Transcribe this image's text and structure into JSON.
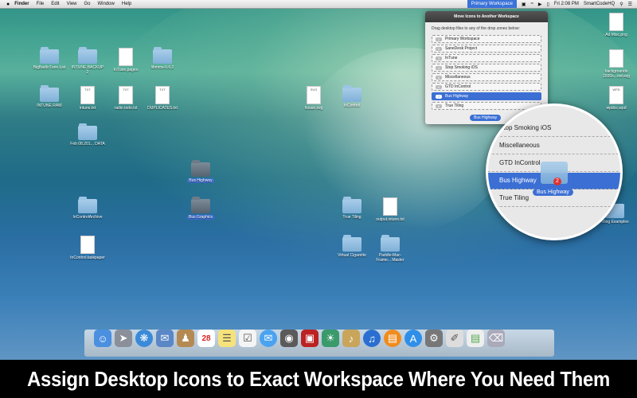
{
  "menubar": {
    "apple": "",
    "items": [
      "Finder",
      "File",
      "Edit",
      "View",
      "Go",
      "Window",
      "Help"
    ],
    "workspace": "Primary Workspace",
    "clock": "Fri 2:08 PM",
    "user": "SmartCodeHQ"
  },
  "panel": {
    "title": "Move Icons to Another Workspace",
    "instructions": "Drag desktop files to any of the drop zones below:",
    "zones": [
      {
        "n": "1",
        "label": "Primary Workspace"
      },
      {
        "n": "2",
        "label": "SaneDesk Project"
      },
      {
        "n": "3",
        "label": "InTune"
      },
      {
        "n": "4",
        "label": "Stop Smoking iOS"
      },
      {
        "n": "5",
        "label": "Miscellaneous"
      },
      {
        "n": "6",
        "label": "GTD InControl"
      },
      {
        "n": "7",
        "label": "Bus Highway"
      },
      {
        "n": "8",
        "label": "True Tiling"
      }
    ],
    "drag_label": "Bus Highway"
  },
  "magnifier": {
    "zones": [
      "Stop Smoking iOS",
      "Miscellaneous",
      "GTD InControl",
      "Bus Highway",
      "True Tiling"
    ],
    "drag_label": "Bus Highway",
    "badge": "2"
  },
  "desktop": {
    "icons": [
      {
        "label": "BigBadInTune List",
        "kind": "folder"
      },
      {
        "label": "INTUNE BACKUP 2",
        "kind": "folder"
      },
      {
        "label": "InTune.pages",
        "kind": "doc"
      },
      {
        "label": "libmms-0.6.2",
        "kind": "folder"
      },
      {
        "label": "INTUNE RAW",
        "kind": "folder"
      },
      {
        "label": "intune.txt",
        "kind": "doc"
      },
      {
        "label": "radio todo.txt",
        "kind": "doc"
      },
      {
        "label": "DUPLICATES.txt",
        "kind": "doc"
      },
      {
        "label": "house.svg",
        "kind": "doc"
      },
      {
        "label": "InControl",
        "kind": "folder"
      },
      {
        "label": "Feb 08.201... DATA",
        "kind": "folder"
      },
      {
        "label": "Bus Highway",
        "kind": "folder-dark"
      },
      {
        "label": "Bus Graphics",
        "kind": "folder-dark"
      },
      {
        "label": "InControlArchive",
        "kind": "folder"
      },
      {
        "label": "True Tiling",
        "kind": "folder"
      },
      {
        "label": "output.intune.txt",
        "kind": "doc"
      },
      {
        "label": "InControl.taskpaper",
        "kind": "doc"
      },
      {
        "label": "Virtual Cigarette",
        "kind": "folder"
      },
      {
        "label": "Paddle-Mac-Frame... Master",
        "kind": "folder"
      },
      {
        "label": "Ad Misc.png",
        "kind": "doc"
      },
      {
        "label": "backgrounds 1920x...oot.svg",
        "kind": "doc"
      },
      {
        "label": "wpdoc.wpd",
        "kind": "doc"
      },
      {
        "label": "Tiling Examples",
        "kind": "folder"
      }
    ]
  },
  "dock": {
    "apps": [
      "finder",
      "launchpad",
      "safari",
      "mail",
      "contacts",
      "calendar",
      "notes",
      "reminders",
      "messages",
      "facetime",
      "photo-booth",
      "iphoto",
      "itunes",
      "ibooks",
      "app-store",
      "system-preferences",
      "preview",
      "trash"
    ],
    "calendar_day": "28"
  },
  "banner": {
    "text": "Assign Desktop Icons to Exact Workspace Where You Need Them"
  },
  "colors": {
    "accent": "#3b6fd4",
    "banner_bg": "#000000"
  }
}
